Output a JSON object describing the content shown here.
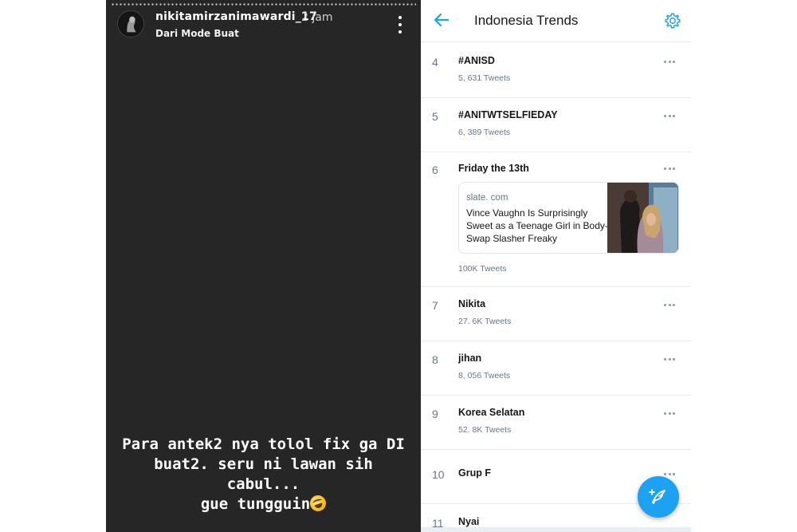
{
  "story": {
    "username": "nikitamirzanimawardi_17",
    "time": "2 jam",
    "subtitle": "Dari Mode Buat",
    "caption_lines": [
      "Para antek2 nya tolol fix ga DI",
      "buat2. seru ni lawan sih cabul...",
      "gue tungguin"
    ],
    "caption_emoji": "rolling-on-the-floor-laughing-emoji",
    "menu_icon": "more-vertical-icon"
  },
  "twitter": {
    "title": "Indonesia Trends",
    "back_icon": "arrow-left-icon",
    "settings_icon": "gear-icon",
    "accent_color": "#1da1f2",
    "trends": [
      {
        "rank": "4",
        "name": "#ANISD",
        "count": "5, 631 Tweets"
      },
      {
        "rank": "5",
        "name": "#ANITWTSELFIEDAY",
        "count": "6, 389 Tweets"
      },
      {
        "rank": "6",
        "name": "Friday the 13th",
        "count": "100K Tweets"
      },
      {
        "rank": "7",
        "name": "Nikita",
        "count": "27. 6K Tweets"
      },
      {
        "rank": "8",
        "name": "jihan",
        "count": "8, 056 Tweets"
      },
      {
        "rank": "9",
        "name": "Korea Selatan",
        "count": "52. 8K Tweets"
      },
      {
        "rank": "10",
        "name": "Grup F",
        "count": ""
      },
      {
        "rank": "11",
        "name": "Nyai",
        "count": ""
      }
    ],
    "card": {
      "domain": "slate. com",
      "headline": "Vince Vaughn Is Surprisingly Sweet as a Teenage Girl in Body-Swap Slasher Freaky"
    },
    "compose_icon": "compose-tweet-icon"
  }
}
